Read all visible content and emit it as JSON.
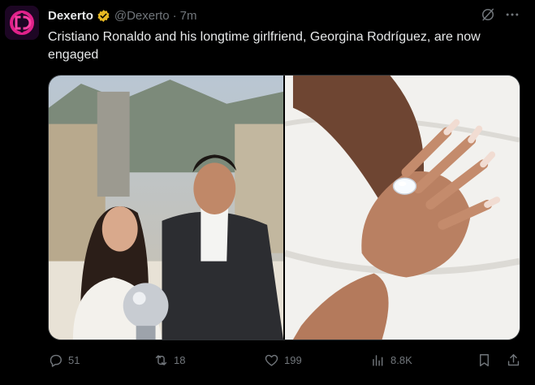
{
  "tweet": {
    "author_name": "Dexerto",
    "handle": "@Dexerto",
    "separator": "·",
    "time": "7m",
    "text": "Cristiano Ronaldo and his longtime girlfriend, Georgina Rodríguez, are now engaged",
    "icons": {
      "verified": "verified-badge-icon",
      "grok": "grok-icon",
      "more": "more-icon"
    },
    "colors": {
      "background": "#000000",
      "text": "#e7e9ea",
      "muted": "#71767b",
      "verified_gold": "#e8b923",
      "avatar_pink": "#e0218a"
    }
  },
  "actions": {
    "replies": "51",
    "reposts": "18",
    "likes": "199",
    "views": "8.8K"
  }
}
